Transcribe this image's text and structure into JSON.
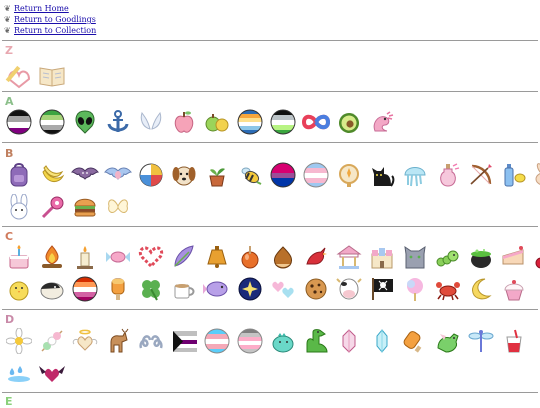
{
  "nav": {
    "links": [
      {
        "label": "Return Home"
      },
      {
        "label": "Return to Goodlings"
      },
      {
        "label": "Return to Collection"
      }
    ]
  },
  "sections": [
    {
      "letter": "Z",
      "color": "#e8a8b0"
    },
    {
      "letter": "A",
      "color": "#8bbf8a"
    },
    {
      "letter": "B",
      "color": "#c08060"
    },
    {
      "letter": "C",
      "color": "#d07a5c"
    },
    {
      "letter": "D",
      "color": "#c98aa8"
    },
    {
      "letter": "E",
      "color": "#8ad07a"
    }
  ],
  "colors": {
    "link": "#1a0dab",
    "divider": "#9a9a9a"
  }
}
